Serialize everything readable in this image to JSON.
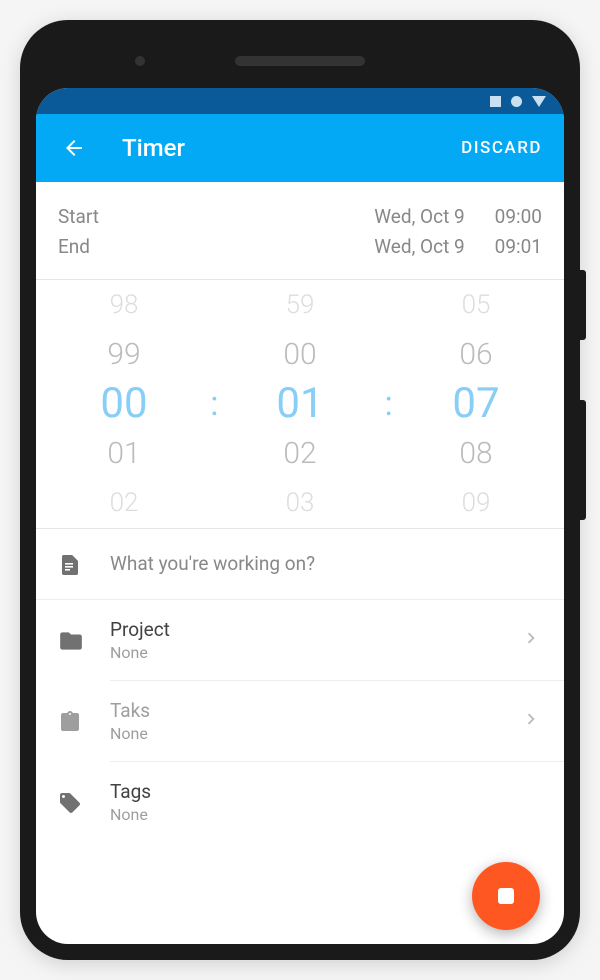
{
  "appBar": {
    "title": "Timer",
    "discard": "DISCARD"
  },
  "times": {
    "startLabel": "Start",
    "endLabel": "End",
    "startDate": "Wed, Oct 9",
    "startTime": "09:00",
    "endDate": "Wed, Oct 9",
    "endTime": "09:01"
  },
  "picker": {
    "col1": {
      "m2": "98",
      "m1": "99",
      "sel": "00",
      "p1": "01",
      "p2": "02"
    },
    "col2": {
      "m2": "59",
      "m1": "00",
      "sel": "01",
      "p1": "02",
      "p2": "03"
    },
    "col3": {
      "m2": "05",
      "m1": "06",
      "sel": "07",
      "p1": "08",
      "p2": "09"
    },
    "sep": ":"
  },
  "description": {
    "placeholder": "What you're working on?"
  },
  "project": {
    "label": "Project",
    "value": "None"
  },
  "task": {
    "label": "Taks",
    "value": "None"
  },
  "tags": {
    "label": "Tags",
    "value": "None"
  }
}
